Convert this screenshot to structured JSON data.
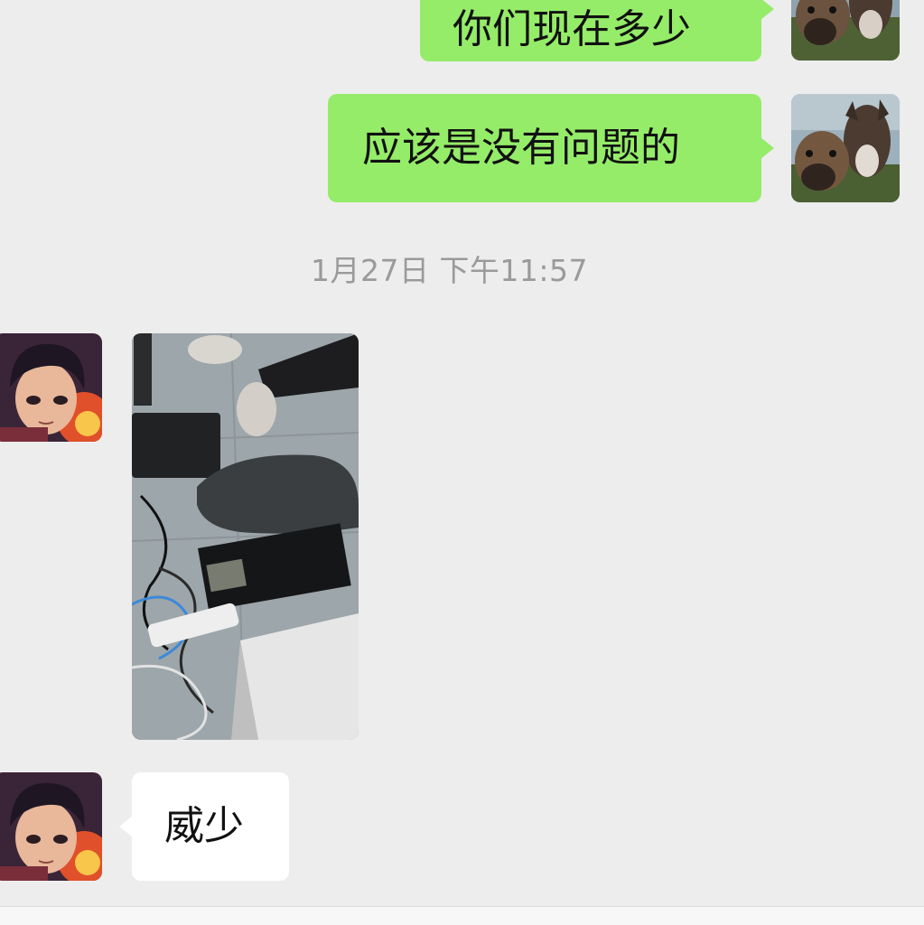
{
  "messages": [
    {
      "sender": "me",
      "text": "你们现在多少"
    },
    {
      "sender": "me",
      "text": "应该是没有问题的"
    },
    {
      "sender": "other",
      "type": "image"
    },
    {
      "sender": "other",
      "text": "威少"
    }
  ],
  "timestamp": "1月27日 下午11:57",
  "colors": {
    "background": "#ededed",
    "my_bubble": "#95ec69",
    "their_bubble": "#ffffff",
    "timestamp_text": "#9a9a9a"
  },
  "icons": {
    "my_avatar": "donkey-photo-avatar",
    "their_avatar": "anime-character-avatar"
  }
}
